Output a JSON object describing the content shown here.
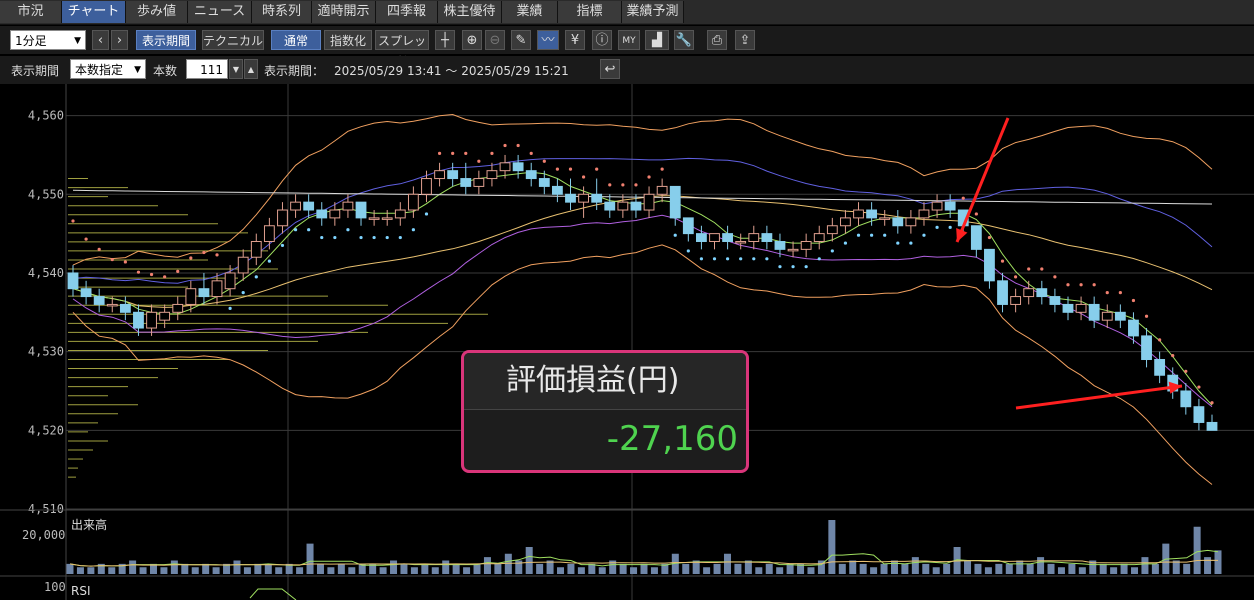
{
  "tabs": [
    {
      "label": "市況",
      "active": false
    },
    {
      "label": "チャート",
      "active": true
    },
    {
      "label": "歩み値",
      "active": false
    },
    {
      "label": "ニュース",
      "active": false
    },
    {
      "label": "時系列",
      "active": false
    },
    {
      "label": "適時開示",
      "active": false
    },
    {
      "label": "四季報",
      "active": false
    },
    {
      "label": "株主優待",
      "active": false
    },
    {
      "label": "業績",
      "active": false
    },
    {
      "label": "指標",
      "active": false
    },
    {
      "label": "業績予測",
      "active": false
    }
  ],
  "toolbar": {
    "interval_value": "1分足",
    "period_button": "表示期間",
    "technical_button": "テクニカル",
    "normal_button": "通常",
    "index_button": "指数化",
    "spread_button": "スプレッド",
    "icons": [
      "crosshair-icon",
      "zoom-in-icon",
      "zoom-out-icon",
      "pencil-icon",
      "line-draw-icon",
      "yen-icon",
      "info-icon",
      "my-indicator-icon",
      "area-chart-icon",
      "wrench-icon",
      "print-icon",
      "export-icon"
    ]
  },
  "period_bar": {
    "label": "表示期間",
    "mode_value": "本数指定",
    "count_label": "本数",
    "count_value": "111",
    "range_label": "表示期間：",
    "range_value": "2025/05/29 13:41 ～ 2025/05/29 15:21"
  },
  "overlay": {
    "title": "評価損益(円)",
    "value": "-27,160"
  },
  "panels": {
    "volume_label": "出来高",
    "volume_tick": "20,000",
    "rsi_label": "RSI",
    "rsi_tick": "100"
  },
  "colors": {
    "up_candle": "#000000",
    "down_candle": "#87ceeb",
    "sar": "#f08070",
    "bollinger_outer": "#f0a060",
    "bollinger_inner": "#b060e0",
    "volume_bar": "#6f86a8",
    "arrow": "#ff2020",
    "accent": "#3d5f9c",
    "profit_negative_text": "#4fd34f",
    "overlay_border": "#d9357a"
  },
  "chart_data": {
    "type": "candlestick",
    "title": "",
    "ylim": [
      4510,
      4563
    ],
    "yticks": [
      "4,510",
      "4,520",
      "4,530",
      "4,540",
      "4,550",
      "4,560"
    ],
    "candles": [
      [
        4540,
        4541,
        4537,
        4538
      ],
      [
        4538,
        4539,
        4536,
        4537
      ],
      [
        4537,
        4538,
        4535,
        4536
      ],
      [
        4536,
        4537,
        4535,
        4536
      ],
      [
        4536,
        4537,
        4534,
        4535
      ],
      [
        4535,
        4536,
        4532,
        4533
      ],
      [
        4533,
        4536,
        4532,
        4535
      ],
      [
        4534,
        4536,
        4533,
        4535
      ],
      [
        4535,
        4537,
        4534,
        4536
      ],
      [
        4536,
        4539,
        4535,
        4538
      ],
      [
        4538,
        4540,
        4536,
        4537
      ],
      [
        4537,
        4540,
        4536,
        4539
      ],
      [
        4538,
        4541,
        4537,
        4540
      ],
      [
        4540,
        4543,
        4539,
        4542
      ],
      [
        4542,
        4545,
        4541,
        4544
      ],
      [
        4544,
        4547,
        4543,
        4546
      ],
      [
        4546,
        4549,
        4545,
        4548
      ],
      [
        4548,
        4550,
        4547,
        4549
      ],
      [
        4549,
        4550,
        4547,
        4548
      ],
      [
        4548,
        4549,
        4546,
        4547
      ],
      [
        4547,
        4549,
        4546,
        4548
      ],
      [
        4548,
        4550,
        4547,
        4549
      ],
      [
        4549,
        4549,
        4546,
        4547
      ],
      [
        4547,
        4548,
        4546,
        4547
      ],
      [
        4547,
        4548,
        4546,
        4547
      ],
      [
        4547,
        4549,
        4546,
        4548
      ],
      [
        4548,
        4551,
        4547,
        4550
      ],
      [
        4550,
        4553,
        4549,
        4552
      ],
      [
        4552,
        4554,
        4551,
        4553
      ],
      [
        4553,
        4554,
        4551,
        4552
      ],
      [
        4552,
        4554,
        4550,
        4551
      ],
      [
        4551,
        4553,
        4550,
        4552
      ],
      [
        4552,
        4554,
        4551,
        4553
      ],
      [
        4553,
        4555,
        4552,
        4554
      ],
      [
        4554,
        4555,
        4552,
        4553
      ],
      [
        4553,
        4554,
        4551,
        4552
      ],
      [
        4552,
        4553,
        4550,
        4551
      ],
      [
        4551,
        4552,
        4549,
        4550
      ],
      [
        4550,
        4552,
        4548,
        4549
      ],
      [
        4549,
        4551,
        4547,
        4550
      ],
      [
        4550,
        4552,
        4548,
        4549
      ],
      [
        4549,
        4550,
        4547,
        4548
      ],
      [
        4548,
        4550,
        4547,
        4549
      ],
      [
        4549,
        4550,
        4547,
        4548
      ],
      [
        4548,
        4551,
        4547,
        4550
      ],
      [
        4550,
        4552,
        4549,
        4551
      ],
      [
        4551,
        4551,
        4546,
        4547
      ],
      [
        4547,
        4547,
        4544,
        4545
      ],
      [
        4545,
        4546,
        4543,
        4544
      ],
      [
        4544,
        4545,
        4543,
        4545
      ],
      [
        4545,
        4546,
        4543,
        4544
      ],
      [
        4544,
        4545,
        4543,
        4544
      ],
      [
        4544,
        4546,
        4543,
        4545
      ],
      [
        4545,
        4546,
        4543,
        4544
      ],
      [
        4544,
        4545,
        4542,
        4543
      ],
      [
        4543,
        4544,
        4542,
        4543
      ],
      [
        4543,
        4545,
        4542,
        4544
      ],
      [
        4544,
        4546,
        4543,
        4545
      ],
      [
        4545,
        4547,
        4544,
        4546
      ],
      [
        4546,
        4548,
        4545,
        4547
      ],
      [
        4547,
        4549,
        4546,
        4548
      ],
      [
        4548,
        4549,
        4546,
        4547
      ],
      [
        4547,
        4548,
        4546,
        4547
      ],
      [
        4547,
        4548,
        4545,
        4546
      ],
      [
        4546,
        4548,
        4545,
        4547
      ],
      [
        4547,
        4549,
        4546,
        4548
      ],
      [
        4548,
        4550,
        4547,
        4549
      ],
      [
        4549,
        4550,
        4547,
        4548
      ],
      [
        4548,
        4548,
        4545,
        4546
      ],
      [
        4546,
        4546,
        4542,
        4543
      ],
      [
        4543,
        4543,
        4538,
        4539
      ],
      [
        4539,
        4540,
        4535,
        4536
      ],
      [
        4536,
        4538,
        4535,
        4537
      ],
      [
        4537,
        4539,
        4536,
        4538
      ],
      [
        4538,
        4539,
        4536,
        4537
      ],
      [
        4537,
        4538,
        4535,
        4536
      ],
      [
        4536,
        4537,
        4534,
        4535
      ],
      [
        4535,
        4537,
        4534,
        4536
      ],
      [
        4536,
        4537,
        4533,
        4534
      ],
      [
        4534,
        4536,
        4533,
        4535
      ],
      [
        4535,
        4536,
        4533,
        4534
      ],
      [
        4534,
        4535,
        4531,
        4532
      ],
      [
        4532,
        4533,
        4528,
        4529
      ],
      [
        4529,
        4530,
        4526,
        4527
      ],
      [
        4527,
        4528,
        4524,
        4525
      ],
      [
        4525,
        4526,
        4522,
        4523
      ],
      [
        4523,
        4524,
        4520,
        4521
      ],
      [
        4521,
        4522,
        4520,
        4520
      ]
    ],
    "volume": [
      3,
      2,
      2,
      3,
      2,
      3,
      4,
      2,
      3,
      2,
      4,
      3,
      2,
      3,
      2,
      3,
      4,
      2,
      3,
      3,
      2,
      3,
      2,
      9,
      3,
      2,
      3,
      2,
      3,
      3,
      2,
      4,
      3,
      2,
      3,
      2,
      4,
      3,
      2,
      3,
      5,
      3,
      6,
      4,
      8,
      3,
      4,
      2,
      3,
      2,
      3,
      2,
      4,
      3,
      2,
      3,
      2,
      3,
      6,
      3,
      4,
      2,
      3,
      6,
      3,
      4,
      2,
      3,
      2,
      3,
      3,
      2,
      4,
      16,
      3,
      4,
      3,
      2,
      3,
      4,
      3,
      5,
      3,
      2,
      3,
      8,
      4,
      3,
      2,
      3,
      3,
      4,
      3,
      5,
      3,
      2,
      3,
      2,
      4,
      3,
      2,
      3,
      2,
      5,
      3,
      9,
      4,
      3,
      14,
      5,
      7
    ],
    "arrows": [
      {
        "from": [
          1008,
          118
        ],
        "to": [
          957,
          242
        ]
      },
      {
        "from": [
          1016,
          408
        ],
        "to": [
          1182,
          386
        ]
      }
    ]
  }
}
